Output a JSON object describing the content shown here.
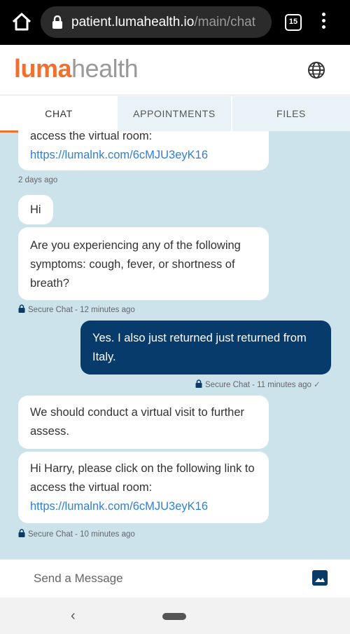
{
  "browser": {
    "url_host": "patient.lumahealth.io",
    "url_path": "/main/chat",
    "tab_count": "15"
  },
  "app": {
    "logo_part1": "luma",
    "logo_part2": "health",
    "accent_color": "#f07030"
  },
  "tabs": [
    {
      "label": "CHAT",
      "active": true
    },
    {
      "label": "APPOINTMENTS",
      "active": false
    },
    {
      "label": "FILES",
      "active": false
    }
  ],
  "messages": {
    "m0_line": "access the virtual room:",
    "m0_link": "https://lumalnk.com/6cMJU3eyK16",
    "date_sep": "2 days ago",
    "m1": "Hi",
    "m2": "Are you experiencing any of the following symptoms: cough, fever, or shortness of breath?",
    "meta1": "Secure Chat - 12 minutes ago",
    "m3": "Yes. I also just returned just returned from Italy.",
    "meta2": "Secure Chat - 11 minutes ago",
    "m4": "We should conduct a virtual visit to further assess.",
    "m5_text": "Hi Harry, please click on the following link to access the virtual room:",
    "m5_link": "https://lumalnk.com/6cMJU3eyK16",
    "meta3": "Secure Chat - 10 minutes ago"
  },
  "composer": {
    "placeholder": "Send a Message"
  },
  "icons": {
    "home": "home-icon",
    "lock": "lock-icon",
    "tabs": "tabs-count-icon",
    "menu": "kebab-menu-icon",
    "globe": "globe-icon",
    "image": "image-icon",
    "back": "back-icon"
  }
}
